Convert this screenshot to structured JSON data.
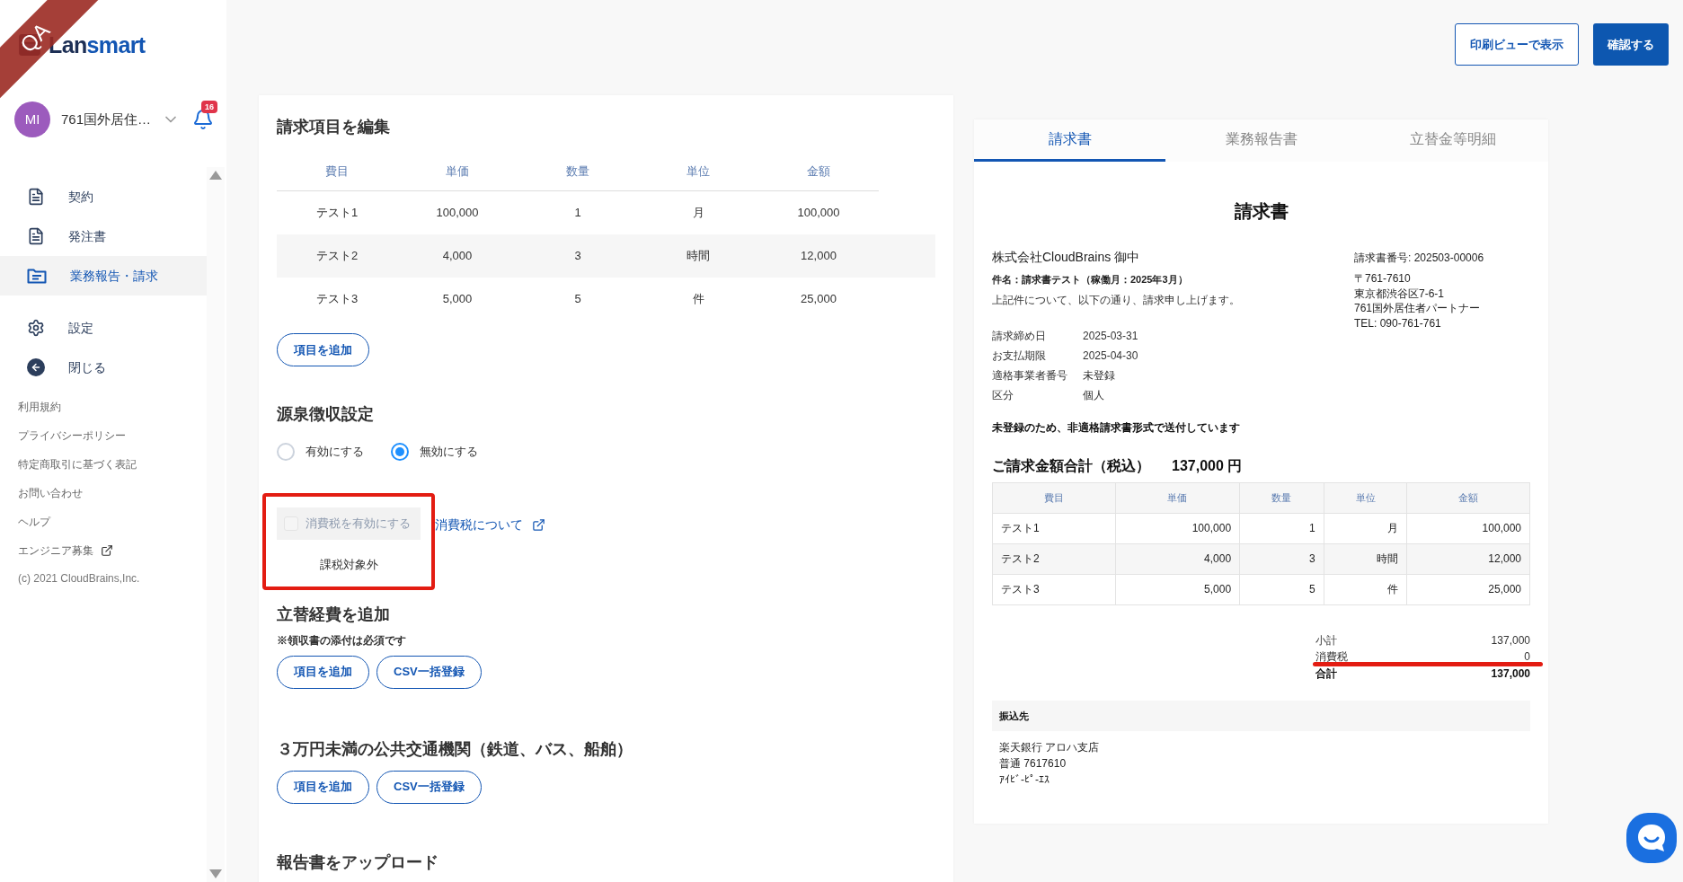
{
  "env_ribbon": "QA",
  "sidebar": {
    "logo_parts": [
      "Lan",
      "smart"
    ],
    "user": {
      "initials": "MI",
      "name": "761国外居住…"
    },
    "notifications": "16",
    "nav": [
      {
        "label": "契約",
        "kind": "document",
        "selected": false
      },
      {
        "label": "発注書",
        "kind": "document",
        "selected": false
      },
      {
        "label": "業務報告・請求",
        "kind": "folder",
        "selected": true
      },
      {
        "label": "設定",
        "kind": "gear",
        "selected": false
      },
      {
        "label": "閉じる",
        "kind": "back",
        "selected": false
      }
    ],
    "links": [
      {
        "label": "利用規約",
        "external": false
      },
      {
        "label": "プライバシーポリシー",
        "external": false
      },
      {
        "label": "特定商取引に基づく表記",
        "external": false
      },
      {
        "label": "お問い合わせ",
        "external": false
      },
      {
        "label": "ヘルプ",
        "external": false
      },
      {
        "label": "エンジニア募集",
        "external": true
      }
    ],
    "copyright": "(c) 2021 CloudBrains,Inc."
  },
  "header_buttons": [
    {
      "label": "印刷ビューで表示",
      "kind": "outline"
    },
    {
      "label": "確認する",
      "kind": "primary"
    }
  ],
  "editor": {
    "title": "請求項目を編集",
    "columns": [
      "費目",
      "単価",
      "数量",
      "単位",
      "金額"
    ],
    "rows": [
      [
        "テスト1",
        "100,000",
        "1",
        "月",
        "100,000"
      ],
      [
        "テスト2",
        "4,000",
        "3",
        "時間",
        "12,000"
      ],
      [
        "テスト3",
        "5,000",
        "5",
        "件",
        "25,000"
      ]
    ],
    "add_button": "項目を追加",
    "withholding": {
      "title": "源泉徴収設定",
      "options": [
        {
          "label": "有効にする",
          "selected": false
        },
        {
          "label": "無効にする",
          "selected": true
        }
      ]
    },
    "tax": {
      "label": "消費税を有効にする",
      "checked": false,
      "disabled": true,
      "highlighted": true,
      "link": "消費税について",
      "status": "課税対象外"
    },
    "expenses": {
      "title": "立替経費を追加",
      "note": "※領収書の添付は必須です",
      "buttons": [
        "項目を追加",
        "CSV一括登録"
      ]
    },
    "transit": {
      "title": "３万円未満の公共交通機関（鉄道、バス、船舶）",
      "buttons": [
        "項目を追加",
        "CSV一括登録"
      ]
    },
    "upload": {
      "title": "報告書をアップロード"
    }
  },
  "invoice": {
    "tabs": [
      {
        "label": "請求書",
        "selected": true
      },
      {
        "label": "業務報告書",
        "selected": false
      },
      {
        "label": "立替金等明細",
        "selected": false
      }
    ],
    "title": "請求書",
    "recipient": "株式会社CloudBrains 御中",
    "subject": "件名：請求書テスト（稼働月：2025年3月）",
    "greeting": "上記件について、以下の通り、請求申し上げます。",
    "number": "請求書番号: 202503-00006",
    "issuer": [
      "〒761-7610",
      "東京都渋谷区7-6-1",
      "761国外居住者パートナー",
      "TEL: 090-761-761"
    ],
    "details": [
      {
        "label": "請求締め日",
        "value": "2025-03-31"
      },
      {
        "label": "お支払期限",
        "value": "2025-04-30"
      },
      {
        "label": "適格事業者番号",
        "value": "未登録"
      },
      {
        "label": "区分",
        "value": "個人"
      }
    ],
    "notice": "未登録のため、非適格請求書形式で送付しています",
    "total_label": "ご請求金額合計（税込）",
    "total_amount": "137,000 円",
    "columns": [
      "費目",
      "単価",
      "数量",
      "単位",
      "金額"
    ],
    "rows": [
      [
        "テスト1",
        "100,000",
        "1",
        "月",
        "100,000"
      ],
      [
        "テスト2",
        "4,000",
        "3",
        "時間",
        "12,000"
      ],
      [
        "テスト3",
        "5,000",
        "5",
        "件",
        "25,000"
      ]
    ],
    "totals": [
      {
        "label": "小計",
        "value": "137,000",
        "bold": false,
        "underlined": false
      },
      {
        "label": "消費税",
        "value": "0",
        "bold": false,
        "underlined": true
      },
      {
        "label": "合計",
        "value": "137,000",
        "bold": true,
        "underlined": false
      }
    ],
    "bank": {
      "title": "振込先",
      "lines": [
        "楽天銀行 アロハ支店",
        "普通 7617610",
        "ｱｲﾋﾞ-ﾋﾟ-ｴｽ"
      ]
    }
  }
}
